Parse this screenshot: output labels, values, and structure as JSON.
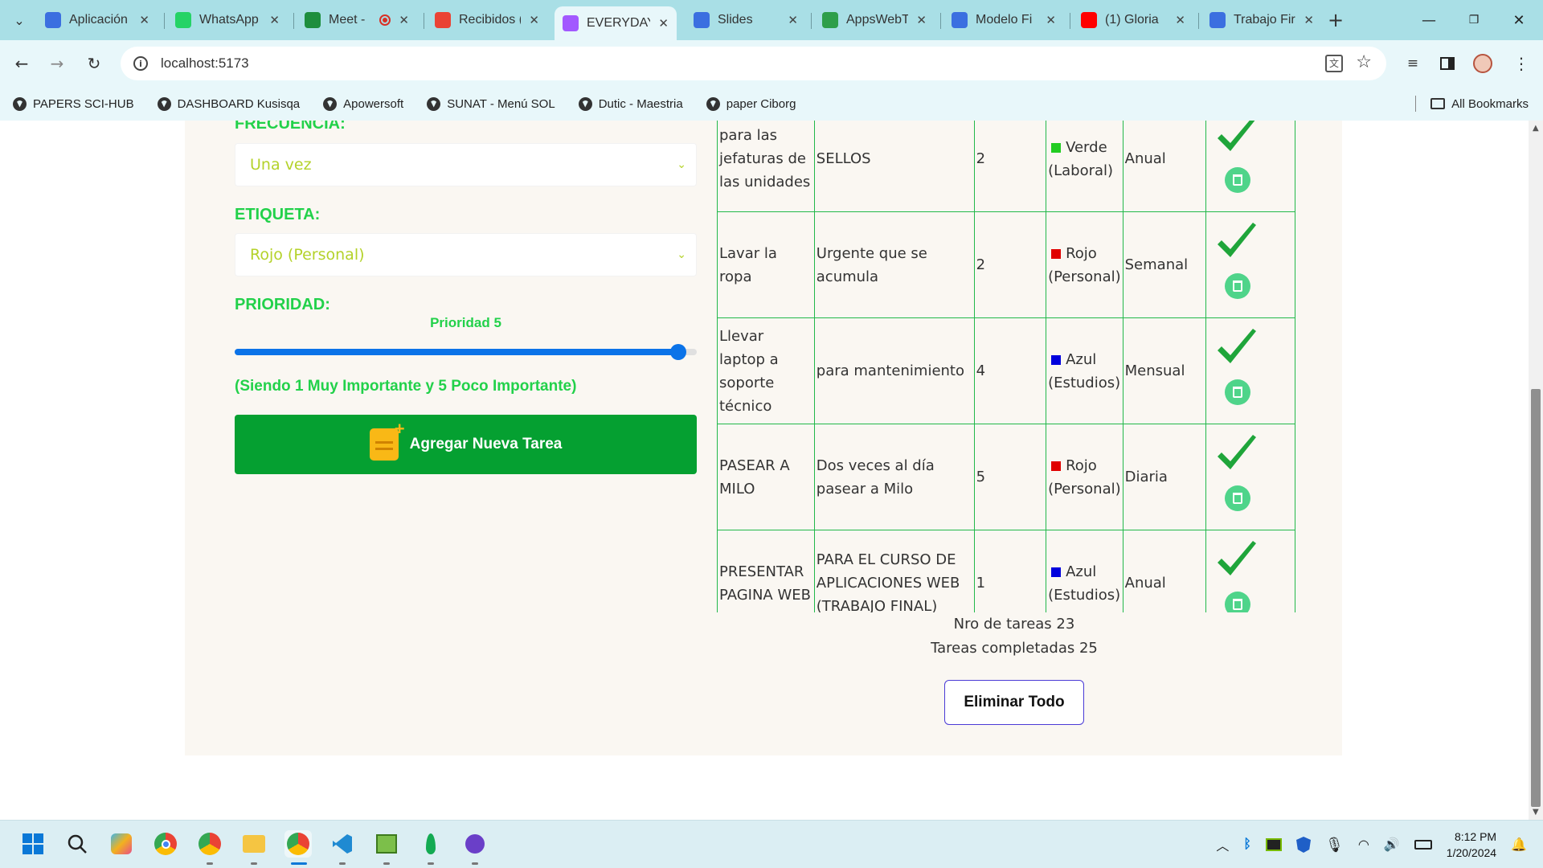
{
  "browser": {
    "tabs": [
      {
        "title": "Aplicación",
        "icon": "user-doc-icon",
        "color": "#3b6fe0"
      },
      {
        "title": "WhatsApp",
        "icon": "whatsapp-icon",
        "color": "#25d366"
      },
      {
        "title": "Meet -",
        "icon": "meet-icon",
        "color": "#1e8e3e",
        "recording": true
      },
      {
        "title": "Recibidos (",
        "icon": "gmail-icon",
        "color": "#ea4335"
      },
      {
        "title": "EVERYDAY",
        "icon": "vite-icon",
        "color": "#a259ff",
        "active": true
      },
      {
        "title": "Slides",
        "icon": "user-doc-icon",
        "color": "#3b6fe0"
      },
      {
        "title": "AppsWebT",
        "icon": "refresh-app-icon",
        "color": "#2e9e4a"
      },
      {
        "title": "Modelo Fi",
        "icon": "user-doc-icon",
        "color": "#3b6fe0"
      },
      {
        "title": "(1) Gloria",
        "icon": "youtube-icon",
        "color": "#ff0000"
      },
      {
        "title": "Trabajo Fir",
        "icon": "user-doc-icon",
        "color": "#3b6fe0"
      }
    ],
    "url": "localhost:5173",
    "bookmarks": [
      "PAPERS SCI-HUB",
      "DASHBOARD Kusisqa",
      "Apowersoft",
      "SUNAT - Menú SOL",
      "Dutic - Maestria",
      "paper Ciborg"
    ],
    "all_bookmarks": "All Bookmarks"
  },
  "form": {
    "frecuencia_label": "FRECUENCIA:",
    "frecuencia_value": "Una vez",
    "etiqueta_label": "ETIQUETA:",
    "etiqueta_value": "Rojo (Personal)",
    "prioridad_label": "PRIORIDAD:",
    "prioridad_text": "Prioridad 5",
    "prioridad_value": 5,
    "prioridad_min": 1,
    "prioridad_max": 5,
    "hint": "(Siendo 1 Muy Importante y 5 Poco Importante)",
    "add_button": "Agregar Nueva Tarea"
  },
  "tasks": [
    {
      "name": "para las jefaturas de las unidades",
      "desc": "SELLOS",
      "priority": "2",
      "tag": "Verde (Laboral)",
      "tag_color": "#22cc22",
      "freq": "Anual"
    },
    {
      "name": "Lavar la ropa",
      "desc": "Urgente que se acumula",
      "priority": "2",
      "tag": "Rojo (Personal)",
      "tag_color": "#e00000",
      "freq": "Semanal"
    },
    {
      "name": "Llevar laptop a soporte técnico",
      "desc": "para mantenimiento",
      "priority": "4",
      "tag": "Azul (Estudios)",
      "tag_color": "#0000dd",
      "freq": "Mensual"
    },
    {
      "name": "PASEAR A MILO",
      "desc": "Dos veces al día pasear a Milo",
      "priority": "5",
      "tag": "Rojo (Personal)",
      "tag_color": "#e00000",
      "freq": "Diaria"
    },
    {
      "name": "PRESENTAR PAGINA WEB",
      "desc": "PARA EL CURSO DE APLICACIONES WEB (TRABAJO FINAL)",
      "priority": "1",
      "tag": "Azul (Estudios)",
      "tag_color": "#0000dd",
      "freq": "Anual"
    }
  ],
  "stats": {
    "total": "Nro de tareas 23",
    "completed": "Tareas completadas 25"
  },
  "delete_all": "Eliminar Todo",
  "taskbar": {
    "time": "8:12 PM",
    "date": "1/20/2024"
  },
  "colors": {
    "accent_green": "#22d14a",
    "button_green": "#05a031",
    "slider_blue": "#0b73e8",
    "select_text": "#b4d22a"
  }
}
